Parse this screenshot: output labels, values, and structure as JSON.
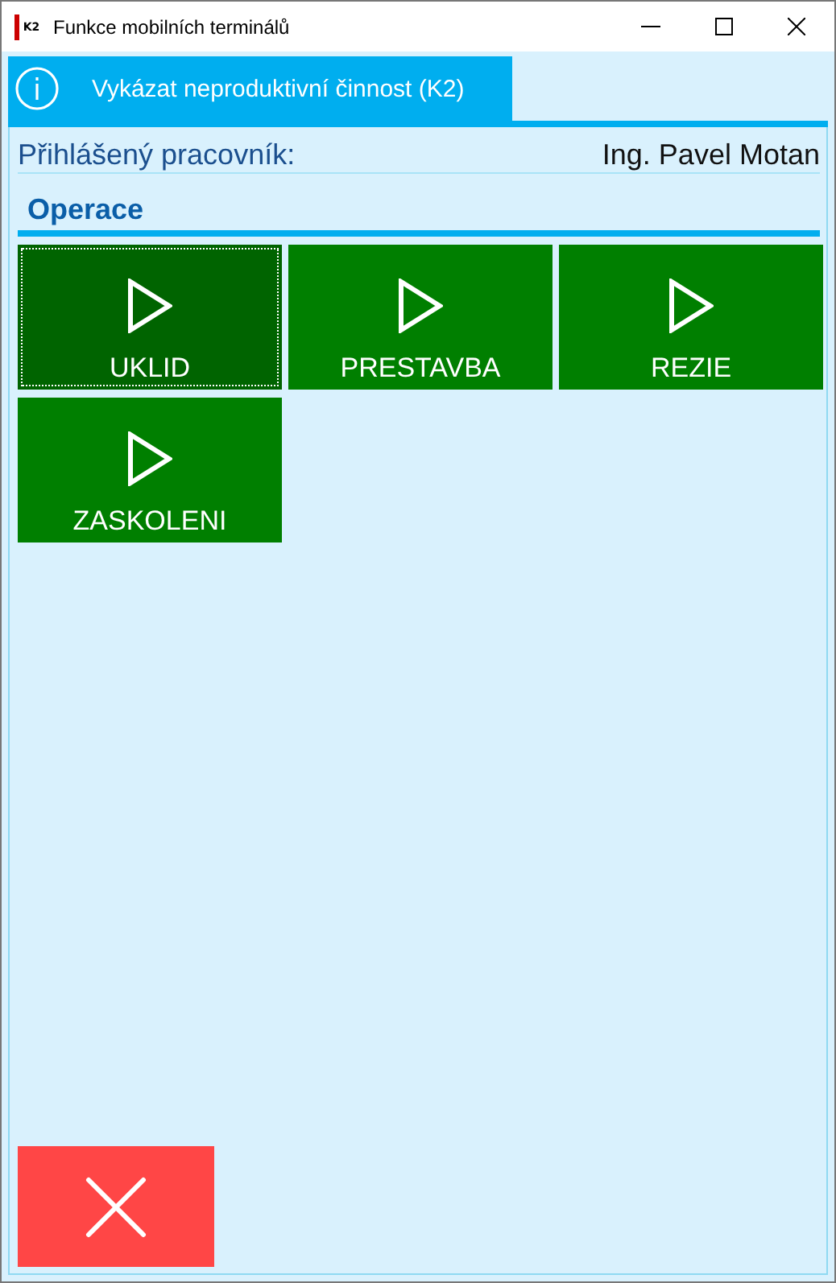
{
  "window": {
    "title": "Funkce mobilních terminálů",
    "logo": "K2"
  },
  "tab": {
    "label": "Vykázat neproduktivní činnost (K2)",
    "selected": true
  },
  "worker": {
    "label": "Přihlášený pracovník:",
    "value": "Ing. Pavel Motan"
  },
  "section": {
    "title": "Operace"
  },
  "operations": [
    {
      "label": "UKLID",
      "focused": true
    },
    {
      "label": "PRESTAVBA",
      "focused": false
    },
    {
      "label": "REZIE",
      "focused": false
    },
    {
      "label": "ZASKOLENI",
      "focused": false
    }
  ]
}
